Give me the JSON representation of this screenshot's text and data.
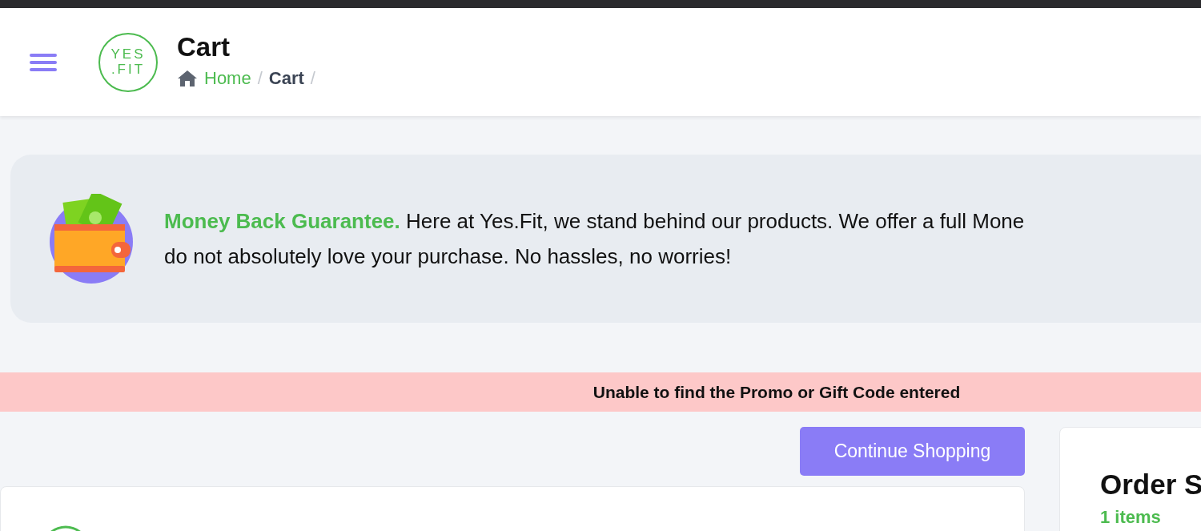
{
  "header": {
    "logo": {
      "line_1": "YES",
      "line_2": ".FIT"
    },
    "title": "Cart",
    "breadcrumb": [
      {
        "label": "Home",
        "kind": "link",
        "separator": "/"
      },
      {
        "label": "Cart",
        "kind": "current",
        "separator": "/"
      }
    ]
  },
  "guarantee": {
    "lines": [
      "**Money Back Guarantee.** Here at Yes.Fit, we stand behind our products. We offer a full Mone",
      "do not absolutely love your purchase. No hassles, no worries!"
    ]
  },
  "alert": {
    "message": "Unable to find the Promo or Gift Code entered"
  },
  "continue_button": "Continue Shopping",
  "order_summary": {
    "title": "Order S",
    "count": "1 items"
  }
}
